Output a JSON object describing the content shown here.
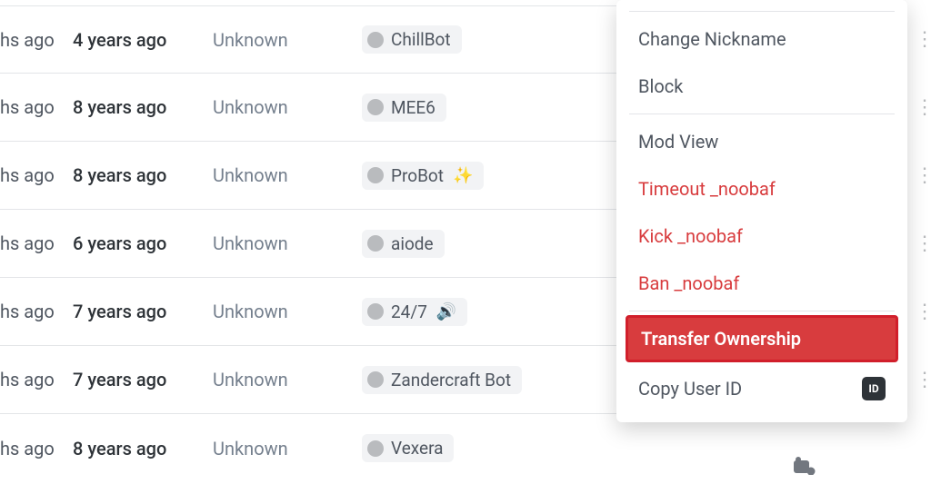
{
  "rows": [
    {
      "time1": "hs ago",
      "time2": "4 years ago",
      "signal": "Unknown",
      "user": "ChillBot",
      "emoji": ""
    },
    {
      "time1": "hs ago",
      "time2": "8 years ago",
      "signal": "Unknown",
      "user": "MEE6",
      "emoji": ""
    },
    {
      "time1": "hs ago",
      "time2": "8 years ago",
      "signal": "Unknown",
      "user": "ProBot",
      "emoji": "✨"
    },
    {
      "time1": "hs ago",
      "time2": "6 years ago",
      "signal": "Unknown",
      "user": "aiode",
      "emoji": ""
    },
    {
      "time1": "hs ago",
      "time2": "7 years ago",
      "signal": "Unknown",
      "user": "24/7",
      "emoji": "🔊"
    },
    {
      "time1": "hs ago",
      "time2": "7 years ago",
      "signal": "Unknown",
      "user": "Zandercraft Bot",
      "emoji": ""
    },
    {
      "time1": "hs ago",
      "time2": "8 years ago",
      "signal": "Unknown",
      "user": "Vexera",
      "emoji": ""
    }
  ],
  "menu": {
    "change_nickname": "Change Nickname",
    "block": "Block",
    "mod_view": "Mod View",
    "timeout": "Timeout _noobaf",
    "kick": "Kick _noobaf",
    "ban": "Ban _noobaf",
    "transfer_ownership": "Transfer Ownership",
    "copy_user_id": "Copy User ID",
    "id_badge": "ID"
  }
}
